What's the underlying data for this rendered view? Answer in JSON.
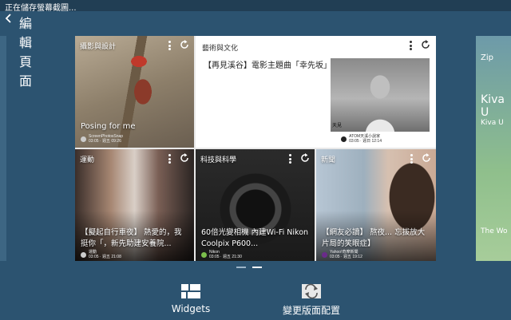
{
  "status": {
    "text": "正在儲存螢幕截圖..."
  },
  "header": {
    "title": "編輯頁面"
  },
  "panel": {
    "tiles": [
      {
        "category": "攝影與設計",
        "caption": "Posing for me",
        "source": "ScreenPhotosSnap\n03:05 · 週五 09:26"
      },
      {
        "category": "藝術與文化",
        "headline": "【再見溪谷】電影主題曲「幸先坂」",
        "photo_tag": "天見",
        "source": "ATOM天溪小說家\n03:05 · 週日 12:14"
      },
      {
        "category": "運動",
        "caption": "【擬起自行車夜】 熱愛的，我\n挺你「，新先助建安養院...",
        "source": "運動\n03:05 · 週五 21:08"
      },
      {
        "category": "科技與科學",
        "caption": "60倍光變相機 內建Wi-Fi Nikon\nCoolpix P600...",
        "source": "Nikon\n03:05 · 週五 21:30"
      },
      {
        "category": "新聞",
        "caption": "【網友必讀】 熬夜... 忘拔放大\n片局的笑眼症】",
        "source": "Yahoo!奇摩新聞\n03:05 · 週五 19:12"
      }
    ]
  },
  "peek_right": {
    "line1": "Zip",
    "line2": "Kiva U",
    "line3": "Kiva U",
    "line4": "The Wo"
  },
  "pager": {
    "count": 2,
    "active": 1
  },
  "actions": {
    "widgets": {
      "label": "Widgets",
      "icon": "widgets-icon"
    },
    "layout": {
      "label": "變更版面配置",
      "icon": "change-layout-icon"
    }
  },
  "colors": {
    "background": "#2c5370",
    "panel": "#e9e9e9",
    "accent": "#ffffff"
  }
}
